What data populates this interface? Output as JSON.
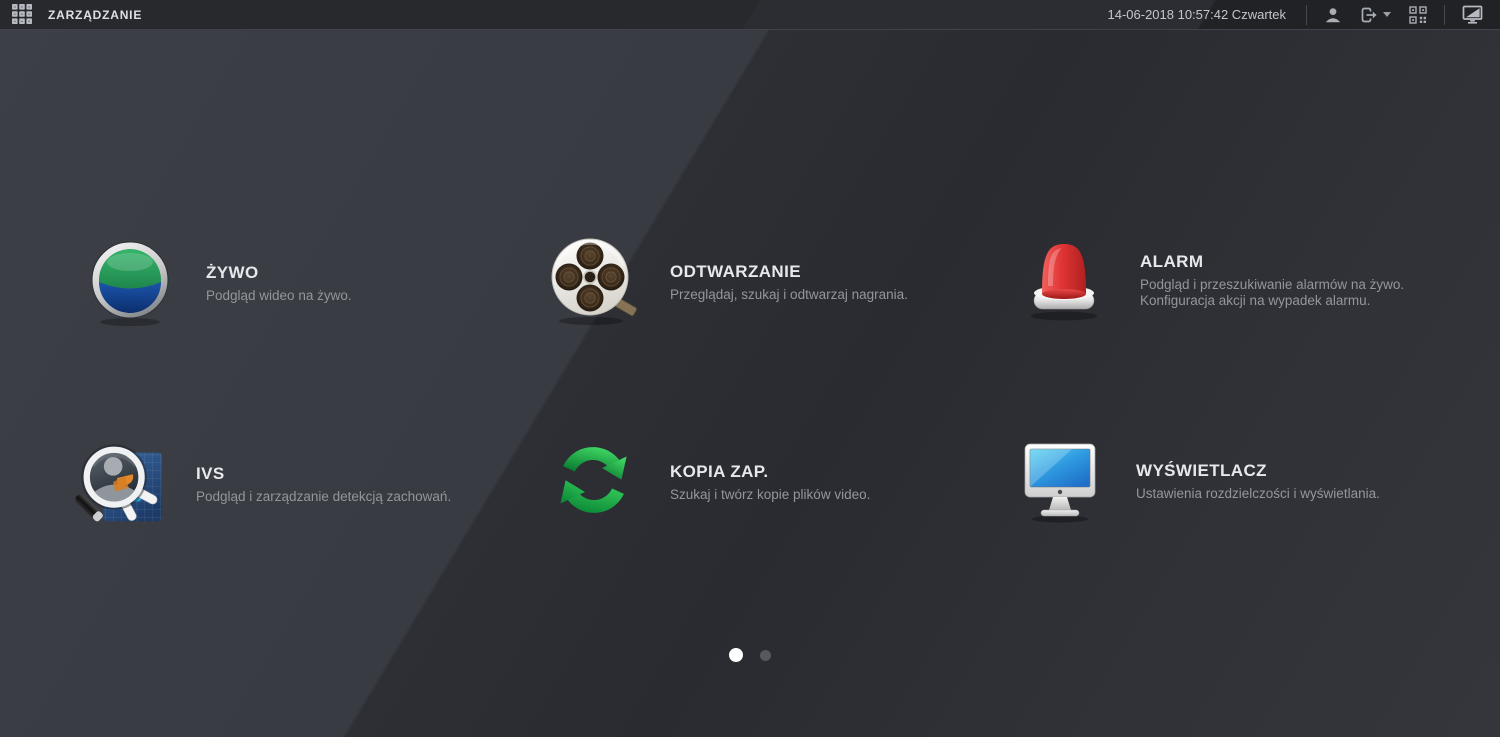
{
  "header": {
    "title": "ZARZĄDZANIE",
    "datetime": "14-06-2018 10:57:42 Czwartek",
    "icons": [
      "apps-grid-icon",
      "user-icon",
      "logout-icon",
      "qrcode-icon",
      "display-mode-icon"
    ]
  },
  "tiles": [
    {
      "id": "zywo",
      "title": "ŻYWO",
      "icon": "live-view-icon",
      "description_lines": [
        "Podgląd wideo na żywo."
      ]
    },
    {
      "id": "odtwarzanie",
      "title": "ODTWARZANIE",
      "icon": "playback-icon",
      "description_lines": [
        "Przeglądaj, szukaj i odtwarzaj nagrania."
      ]
    },
    {
      "id": "alarm",
      "title": "ALARM",
      "icon": "alarm-icon",
      "description_lines": [
        "Podgląd i przeszukiwanie alarmów na żywo.",
        "Konfiguracja akcji na wypadek alarmu."
      ]
    },
    {
      "id": "ivs",
      "title": "IVS",
      "icon": "ivs-icon",
      "description_lines": [
        "Podgląd i zarządzanie detekcją zachowań."
      ]
    },
    {
      "id": "kopia-zap",
      "title": "KOPIA ZAP.",
      "icon": "backup-icon",
      "description_lines": [
        "Szukaj i twórz kopie plików video."
      ]
    },
    {
      "id": "wyswietlacz",
      "title": "WYŚWIETLACZ",
      "icon": "display-icon",
      "description_lines": [
        "Ustawienia rozdzielczości i wyświetlania."
      ]
    }
  ],
  "pagination": {
    "pages": 2,
    "active_page": 1
  },
  "colors": {
    "background": "#2e3036",
    "topbar": "#26282c",
    "title_text": "#e6e8ea",
    "description_text": "#93969a",
    "live_green": "#2fae63",
    "live_blue": "#1b4fa4",
    "alarm_red": "#d92f2f",
    "backup_green": "#23c04f",
    "display_cyan": "#46c4ec"
  }
}
